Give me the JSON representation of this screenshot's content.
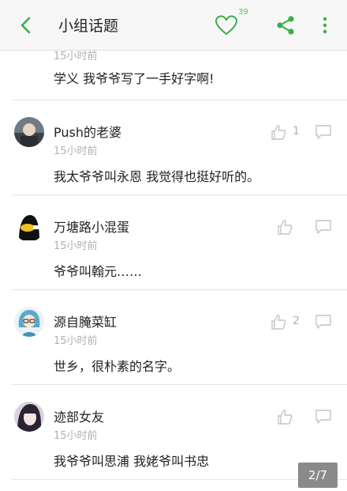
{
  "header": {
    "title": "小组话题",
    "like_count": "39",
    "icons": [
      "back-arrow-icon",
      "heart-icon",
      "share-icon",
      "more-vertical-icon"
    ],
    "accent_color": "#3aad4a"
  },
  "partial_comment": {
    "time": "15小时前",
    "content": "学义 我爷爷写了一手好字啊!"
  },
  "comments": [
    {
      "username": "Push的老婆",
      "time": "15小时前",
      "content": "我太爷爷叫永恩 我觉得也挺好听的。",
      "like_count": "1"
    },
    {
      "username": "万塘路小混蛋",
      "time": "15小时前",
      "content": "爷爷叫翰元……",
      "like_count": ""
    },
    {
      "username": "源自腌菜缸",
      "time": "15小时前",
      "content": "世乡，很朴素的名字。",
      "like_count": "2"
    },
    {
      "username": "迹部女友",
      "time": "15小时前",
      "content": "我爷爷叫思浦 我姥爷叫书忠",
      "like_count": ""
    }
  ],
  "pager": {
    "label": "2/7"
  }
}
